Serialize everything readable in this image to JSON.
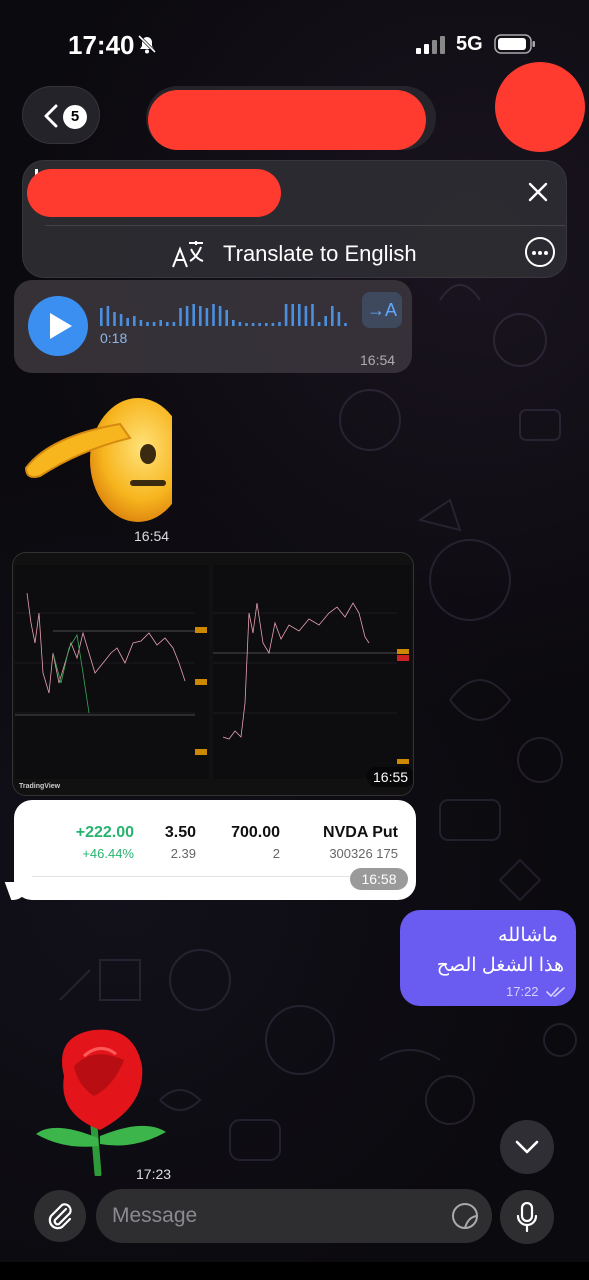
{
  "status_bar": {
    "time": "17:40",
    "network": "5G"
  },
  "header": {
    "back_count": "5"
  },
  "banner": {
    "translate_label": "Translate to English"
  },
  "voice_message": {
    "duration": "0:18",
    "transcribe_label": "→A",
    "time": "16:54"
  },
  "sticker_salute": {
    "time": "16:54"
  },
  "chart_image": {
    "time": "16:55",
    "watermark": "TradingView"
  },
  "position_card": {
    "pl": "+222.00",
    "pl_percent": "+46.44%",
    "price": "3.50",
    "price_sub": "2.39",
    "qty": "700.00",
    "qty_sub": "2",
    "symbol": "NVDA Put",
    "contract": "300326 175",
    "time": "16:58",
    "colors": {
      "gain": "#27b36f"
    }
  },
  "outgoing_message": {
    "line1": "ماشالله",
    "line2": "هذا الشغل الصح",
    "time": "17:22"
  },
  "sticker_rose": {
    "time": "17:23"
  },
  "input_bar": {
    "placeholder": "Message"
  },
  "colors": {
    "accent": "#3a8ff0",
    "outgoing_bubble": "#6a5cf0",
    "redaction": "#ff3b30"
  }
}
